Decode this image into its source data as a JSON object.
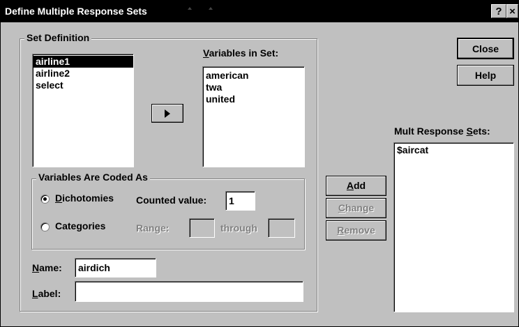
{
  "window": {
    "title": "Define Multiple Response Sets",
    "help_glyph": "?",
    "close_glyph": "×"
  },
  "set_definition": {
    "title": "Set Definition",
    "source_variables": [
      "airline1",
      "airline2",
      "select"
    ],
    "selected_source": "airline1",
    "move_button_icon": "right-arrow-icon",
    "variables_in_set_label_mnemonic": "V",
    "variables_in_set_label_rest": "ariables in Set:",
    "variables_in_set": [
      "american",
      "twa",
      "united"
    ],
    "coded_as": {
      "title": "Variables Are Coded As",
      "dichotomies_mnemonic": "D",
      "dichotomies_rest": "ichotomies",
      "dichotomies_selected": true,
      "counted_value_label": "Counted value:",
      "counted_value": "1",
      "categories_label": "Categories",
      "categories_selected": false,
      "range_label": "Range:",
      "through_label": "through",
      "range_from": "",
      "range_to": ""
    },
    "name_label_mnemonic": "N",
    "name_label_rest": "ame:",
    "name_value": "airdich",
    "label_label_mnemonic": "L",
    "label_label_rest": "abel:",
    "label_value": ""
  },
  "buttons": {
    "close": "Close",
    "help": "Help",
    "add_mnemonic": "A",
    "add_rest": "dd",
    "change_mnemonic": "C",
    "change_rest": "hange",
    "remove_mnemonic": "R",
    "remove_rest": "emove"
  },
  "mult_response_sets": {
    "label_prefix": "Mult Response ",
    "label_mnemonic": "S",
    "label_rest": "ets:",
    "items": [
      "$aircat"
    ]
  },
  "colors": {
    "dialog_face": "#c0c0c0",
    "title_bar": "#000000",
    "selection": "#000000",
    "disabled_text": "#808080"
  }
}
